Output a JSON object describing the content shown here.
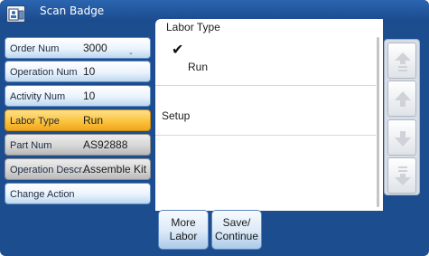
{
  "window": {
    "title": "Scan Badge",
    "icon": "badge-scan-icon"
  },
  "fields": [
    {
      "label": "Order Num",
      "value": "3000",
      "state": "normal"
    },
    {
      "label": "Operation Num",
      "value": "10",
      "state": "normal"
    },
    {
      "label": "Activity Num",
      "value": "10",
      "state": "normal"
    },
    {
      "label": "Labor Type",
      "value": "Run",
      "state": "active"
    },
    {
      "label": "Part Num",
      "value": "AS92888",
      "state": "readonly"
    },
    {
      "label": "Operation Descr...",
      "value": "Assemble Kit",
      "state": "readonly"
    },
    {
      "label": "Change Action",
      "value": "",
      "state": "normal"
    }
  ],
  "panel": {
    "title": "Labor Type",
    "options": [
      {
        "label": "Run",
        "selected": true
      },
      {
        "label": "Setup",
        "selected": false
      }
    ],
    "check_glyph": "✔"
  },
  "nav_buttons": [
    {
      "name": "scroll-top-icon",
      "enabled": false
    },
    {
      "name": "scroll-up-icon",
      "enabled": false
    },
    {
      "name": "scroll-down-icon",
      "enabled": false
    },
    {
      "name": "scroll-bottom-icon",
      "enabled": false
    }
  ],
  "actions": {
    "more_labor_line1": "More",
    "more_labor_line2": "Labor",
    "save_line1": "Save/",
    "save_line2": "Continue"
  },
  "colors": {
    "frame": "#1c4d8f",
    "active_field": "#fbc33e",
    "readonly_field": "#d6d6d6",
    "field": "#eaf3fc"
  }
}
